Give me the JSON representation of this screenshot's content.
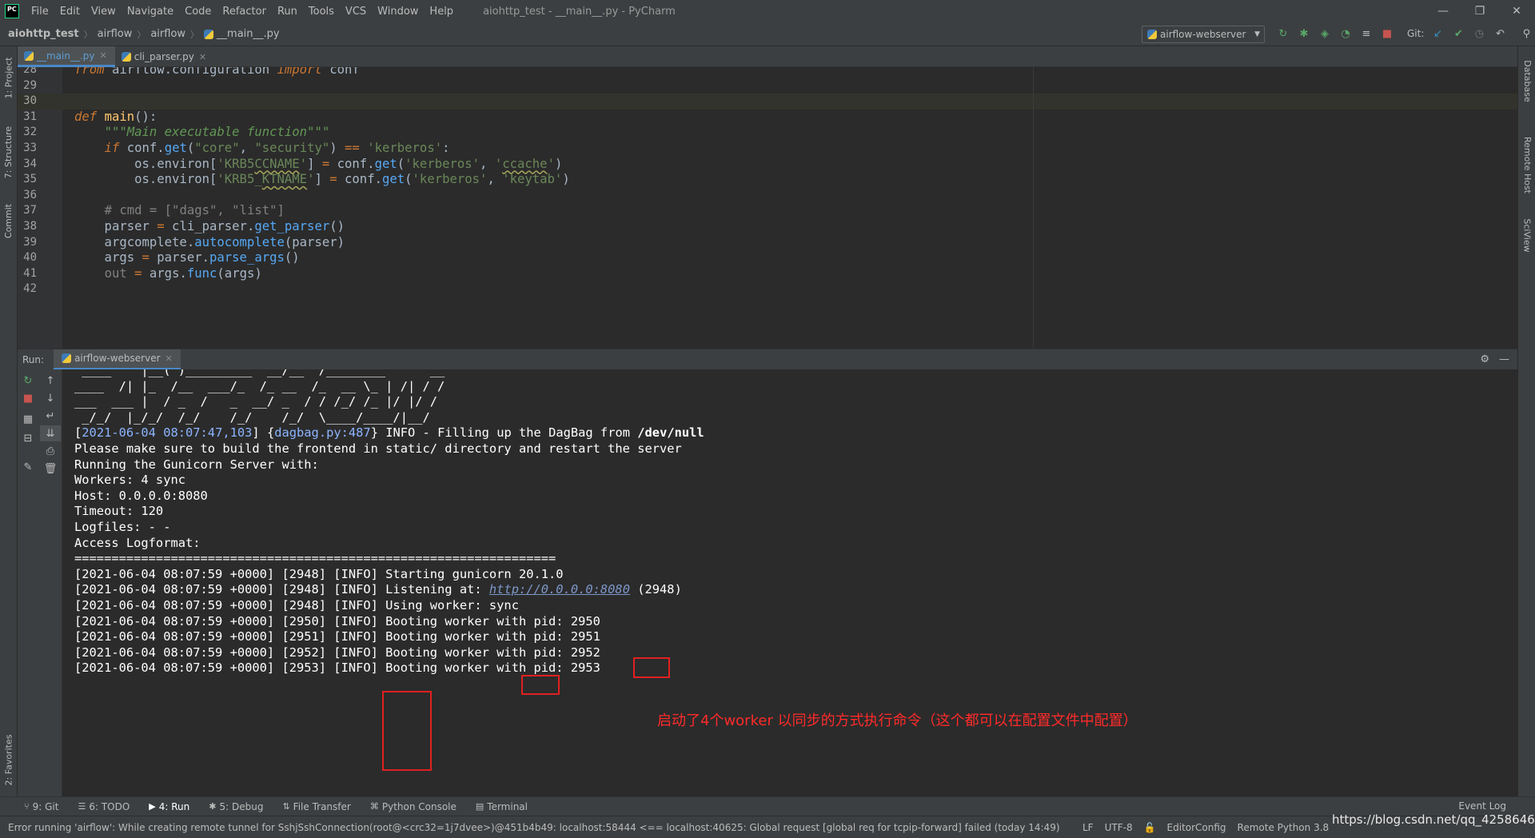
{
  "titlebar": {
    "logo": "PC",
    "menu": [
      "File",
      "Edit",
      "View",
      "Navigate",
      "Code",
      "Refactor",
      "Run",
      "Tools",
      "VCS",
      "Window",
      "Help"
    ],
    "title": "aiohttp_test - __main__.py - PyCharm",
    "controls": [
      "—",
      "❐",
      "✕"
    ]
  },
  "navbar": {
    "crumbs": [
      "aiohttp_test",
      "airflow",
      "airflow",
      "__main__.py"
    ],
    "run_config": "airflow-webserver",
    "git_label": "Git:"
  },
  "editor_tabs": [
    {
      "name": "__main__.py",
      "active": true
    },
    {
      "name": "cli_parser.py",
      "active": false
    }
  ],
  "left_tools": [
    "1: Project",
    "7: Structure",
    "Commit",
    "2: Favorites"
  ],
  "right_tools": [
    "Database",
    "Remote Host",
    "SciView"
  ],
  "code_lines": [
    {
      "n": "28",
      "html": "<span class=\"kw\">from</span> airflow.configuration <span class=\"kw\">import</span> conf"
    },
    {
      "n": "29",
      "html": ""
    },
    {
      "n": "30",
      "html": "",
      "current": true
    },
    {
      "n": "31",
      "html": "<span class=\"kw\">def</span> <span class=\"fn\">main</span>():"
    },
    {
      "n": "32",
      "html": "    <span class=\"doc\">\"\"\"Main executable function\"\"\"</span>"
    },
    {
      "n": "33",
      "html": "    <span class=\"kw\">if</span> conf.<span class=\"call\">get</span>(<span class=\"str\">\"core\"</span>, <span class=\"str\">\"security\"</span>) <span class=\"op\">==</span> <span class=\"str\">'kerberos'</span>:"
    },
    {
      "n": "34",
      "html": "        os.environ[<span class=\"str\">'KRB5<span class=\"sq\">CCNAME</span>'</span>] <span class=\"op\">=</span> conf.<span class=\"call\">get</span>(<span class=\"str\">'kerberos'</span>, <span class=\"str\">'<span class=\"sq\">ccache</span>'</span>)"
    },
    {
      "n": "35",
      "html": "        os.environ[<span class=\"str\">'KRB5_<span class=\"sq\">KTNAME</span>'</span>] <span class=\"op\">=</span> conf.<span class=\"call\">get</span>(<span class=\"str\">'kerberos'</span>, <span class=\"str\">'keytab'</span>)"
    },
    {
      "n": "36",
      "html": ""
    },
    {
      "n": "37",
      "html": "    <span class=\"cm\"># cmd = [\"dags\", \"list\"]</span>"
    },
    {
      "n": "38",
      "html": "    parser <span class=\"op\">=</span> cli_parser.<span class=\"call\">get_parser</span>()"
    },
    {
      "n": "39",
      "html": "    argcomplete.<span class=\"call\">autocomplete</span>(parser)"
    },
    {
      "n": "40",
      "html": "    args <span class=\"op\">=</span> parser.<span class=\"call\">parse_args</span>()"
    },
    {
      "n": "41",
      "html": "    <span class=\"cm\">out</span> <span class=\"op\">=</span> args.<span class=\"call\">func</span>(args)"
    },
    {
      "n": "42",
      "html": ""
    }
  ],
  "run_panel": {
    "label": "Run:",
    "tab": "airflow-webserver"
  },
  "console_lines": [
    " ____    |__( )_________  __/__  /________      __",
    "____  /| |_  /__  ___/_  /_ __  /_  __ \\_ | /| / /",
    "___  ___ |  / _  /   _  __/ _  / / /_/ /_ |/ |/ /",
    " _/_/  |_/_/  /_/    /_/    /_/  \\____/____/|__/",
    "[2021-06-04 08:07:47,103] {dagbag.py:487} INFO - Filling up the DagBag from /dev/null",
    "Please make sure to build the frontend in static/ directory and restart the server",
    "Running the Gunicorn Server with:",
    "Workers: 4 sync",
    "Host: 0.0.0.0:8080",
    "Timeout: 120",
    "Logfiles: - -",
    "Access Logformat:",
    "=================================================================",
    "[2021-06-04 08:07:59 +0000] [2948] [INFO] Starting gunicorn 20.1.0",
    "[2021-06-04 08:07:59 +0000] [2948] [INFO] Listening at: http://0.0.0.0:8080 (2948)",
    "[2021-06-04 08:07:59 +0000] [2948] [INFO] Using worker: sync",
    "[2021-06-04 08:07:59 +0000] [2950] [INFO] Booting worker with pid: 2950",
    "[2021-06-04 08:07:59 +0000] [2951] [INFO] Booting worker with pid: 2951",
    "[2021-06-04 08:07:59 +0000] [2952] [INFO] Booting worker with pid: 2952",
    "[2021-06-04 08:07:59 +0000] [2953] [INFO] Booting worker with pid: 2953"
  ],
  "annotation": "启动了4个worker 以同步的方式执行命令（这个都可以在配置文件中配置）",
  "bottom_tools": [
    {
      "icon": "⑂",
      "label": "9: Git"
    },
    {
      "icon": "☰",
      "label": "6: TODO"
    },
    {
      "icon": "▶",
      "label": "4: Run",
      "active": true
    },
    {
      "icon": "✱",
      "label": "5: Debug"
    },
    {
      "icon": "⇅",
      "label": "File Transfer"
    },
    {
      "icon": "⌘",
      "label": "Python Console"
    },
    {
      "icon": "▤",
      "label": "Terminal"
    }
  ],
  "event_log": "Event Log",
  "status": {
    "message": "Error running 'airflow': While creating remote tunnel for SshjSshConnection(root@<crc32=1j7dvee>)@451b4b49: localhost:58444 <== localhost:40625: Global request [global req for tcpip-forward] failed (today 14:49)",
    "line_sep": "LF",
    "encoding": "UTF-8",
    "editor_config": "EditorConfig",
    "interpreter": "Remote Python 3.8"
  },
  "watermark": "https://blog.csdn.net/qq_42586468"
}
